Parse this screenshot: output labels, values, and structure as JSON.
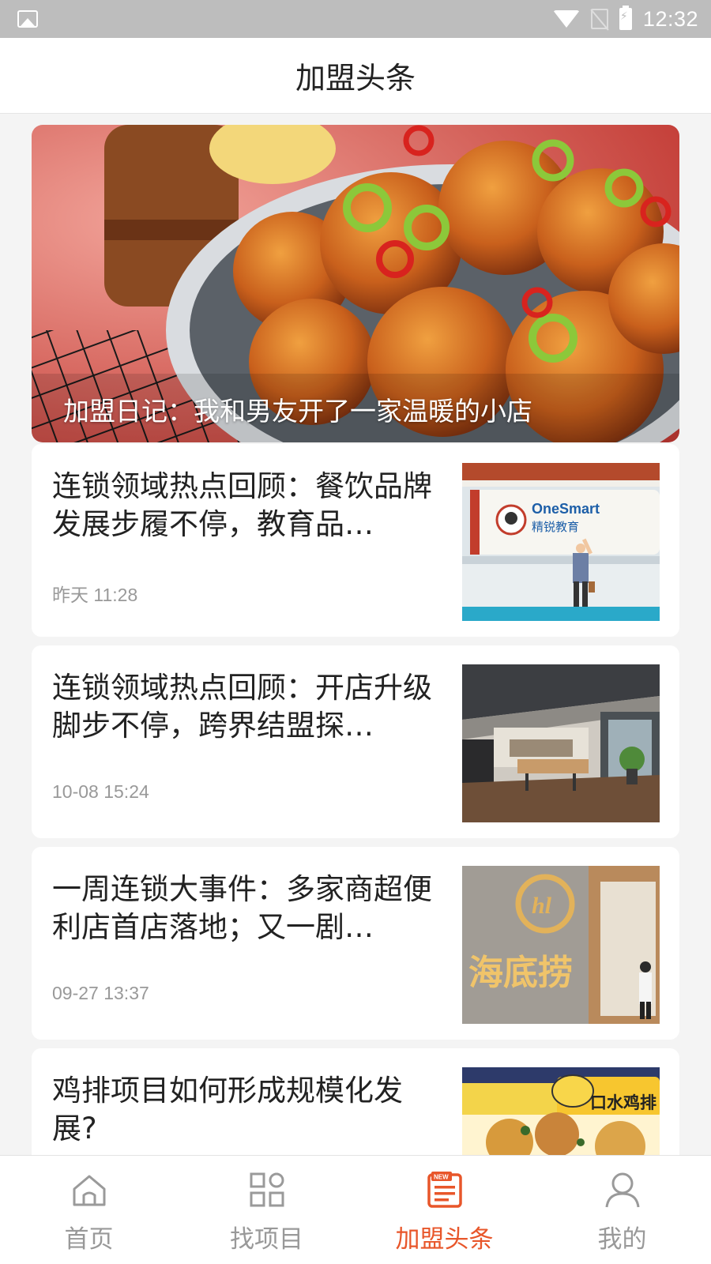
{
  "status_bar": {
    "time": "12:32",
    "icons": [
      "gallery-icon",
      "wifi-icon",
      "no-sim-icon",
      "battery-charging-icon"
    ]
  },
  "header": {
    "title": "加盟头条"
  },
  "banner": {
    "caption": "加盟日记：我和男友开了一家温暖的小店",
    "image": "fried-chicken-with-peppers-photo"
  },
  "articles": [
    {
      "title": "连锁领域热点回顾：餐饮品牌发展步履不停，教育品…",
      "time": "昨天 11:28",
      "thumb": "onesmart-education-book-photo",
      "thumb_text": "OneSmart",
      "thumb_subtext": "精锐教育"
    },
    {
      "title": "连锁领域热点回顾：开店升级脚步不停，跨界结盟探…",
      "time": "10-08 15:24",
      "thumb": "store-interior-photo"
    },
    {
      "title": "一周连锁大事件：多家商超便利店首店落地；又一剧…",
      "time": "09-27 13:37",
      "thumb": "haidilao-sign-photo",
      "thumb_text": "海底捞"
    },
    {
      "title": "鸡排项目如何形成规模化发展?",
      "time": "",
      "thumb": "chicken-chop-food-photo",
      "thumb_text": "口水鸡排"
    }
  ],
  "bottom_nav": {
    "items": [
      {
        "label": "首页",
        "icon": "home-icon",
        "active": false
      },
      {
        "label": "找项目",
        "icon": "grid-icon",
        "active": false
      },
      {
        "label": "加盟头条",
        "icon": "news-icon",
        "active": true
      },
      {
        "label": "我的",
        "icon": "user-icon",
        "active": false
      }
    ],
    "news_badge": "NEW",
    "active_color": "#e8562a",
    "inactive_color": "#999999"
  }
}
